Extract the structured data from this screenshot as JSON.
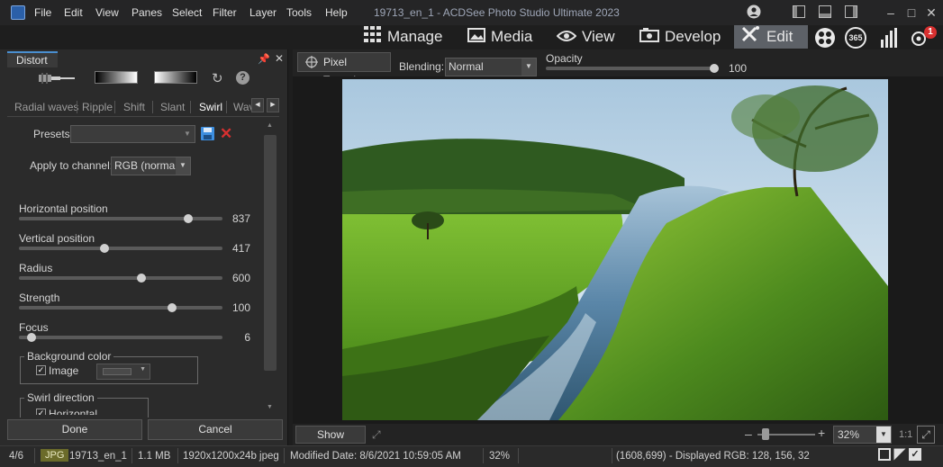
{
  "window": {
    "title": "19713_en_1 - ACDSee Photo Studio Ultimate 2023",
    "menu": [
      "File",
      "Edit",
      "View",
      "Panes",
      "Select",
      "Filter",
      "Layer",
      "Tools",
      "Help"
    ]
  },
  "modes": {
    "manage": "Manage",
    "media": "Media",
    "view": "View",
    "develop": "Develop",
    "edit": "Edit",
    "active": "Edit",
    "badge": "1",
    "extra_365": "365"
  },
  "panel": {
    "title": "Distort",
    "tabs": [
      "Radial waves",
      "Ripple",
      "Shift",
      "Slant",
      "Swirl",
      "Wav"
    ],
    "active_tab": "Swirl",
    "presets_label": "Presets",
    "presets_value": "",
    "channel_label": "Apply to channel:",
    "channel_value": "RGB (normal)",
    "sliders": [
      {
        "label": "Horizontal position",
        "value": "837",
        "fraction": 0.83
      },
      {
        "label": "Vertical position",
        "value": "417",
        "fraction": 0.42
      },
      {
        "label": "Radius",
        "value": "600",
        "fraction": 0.6
      },
      {
        "label": "Strength",
        "value": "100",
        "fraction": 0.75
      },
      {
        "label": "Focus",
        "value": "6",
        "fraction": 0.06
      }
    ],
    "background_group": "Background color",
    "image_checkbox": "Image",
    "image_checked": true,
    "swirl_group": "Swirl direction",
    "horizontal_checkbox": "Horizontal",
    "done_label": "Done",
    "cancel_label": "Cancel"
  },
  "options": {
    "pixel_targeting": "Pixel Targeting",
    "blending_label": "Blending:",
    "blending_value": "Normal",
    "opacity_label": "Opacity",
    "opacity_value": "100",
    "opacity_fraction": 1.0
  },
  "image_bar": {
    "show_previous": "Show Previous",
    "zoom_value": "32%",
    "ratio": "1:1"
  },
  "status": {
    "position": "4/6",
    "format": "JPG",
    "filename": "19713_en_1",
    "filesize": "1.1 MB",
    "dimensions": "1920x1200x24b jpeg",
    "modified": "Modified Date: 8/6/2021 10:59:05 AM",
    "zoom": "32%",
    "pixel_info": "(1608,699) - Displayed RGB: 128, 156, 32"
  },
  "colors": {
    "accent": "#4a8fd0",
    "badge": "#d83030",
    "format_badge": "#6b6b2a"
  }
}
